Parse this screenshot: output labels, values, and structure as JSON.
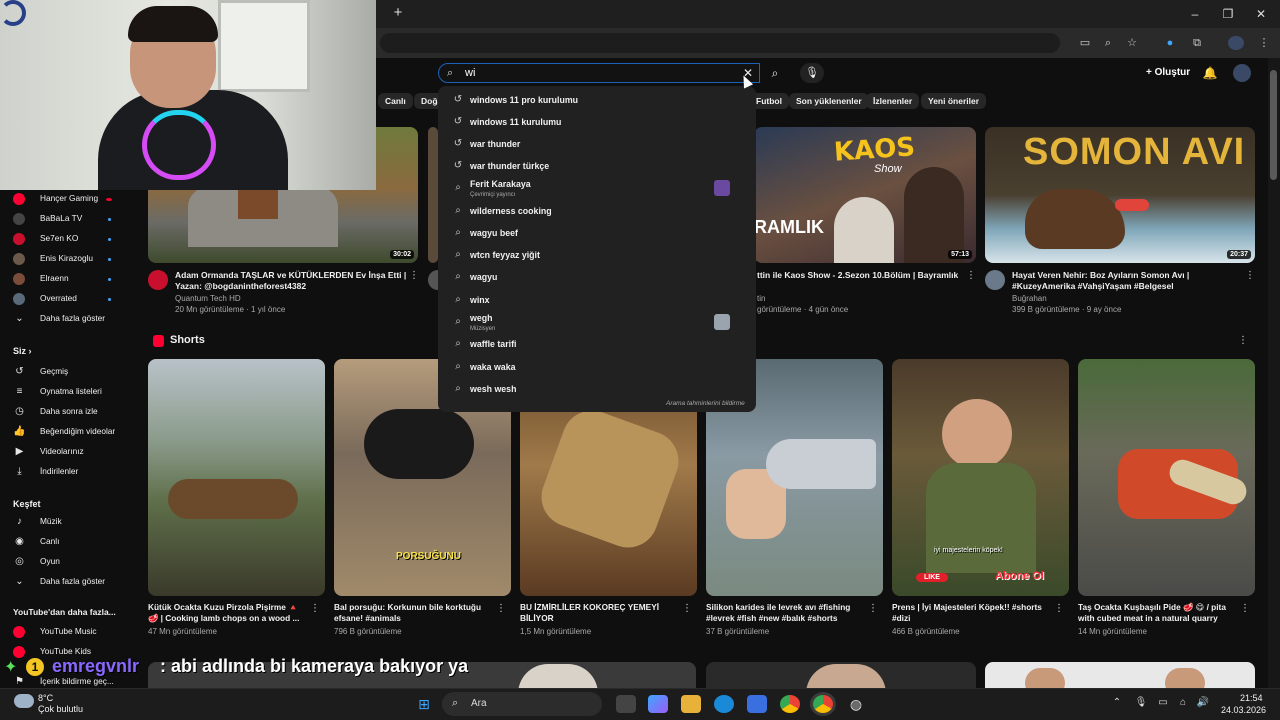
{
  "browser": {
    "new_tab_label": "+",
    "window_controls": [
      "–",
      "❐",
      "✕"
    ]
  },
  "header": {
    "search_query": "wi",
    "create_label": "Oluştur"
  },
  "chips": [
    "Canlı",
    "Doğa",
    "Futbol",
    "Son yüklenenler",
    "İzlenenler",
    "Yeni öneriler"
  ],
  "search_suggestions": [
    {
      "text": "windows 11 pro kurulumu",
      "icon": "history-icon"
    },
    {
      "text": "windows 11 kurulumu",
      "icon": "history-icon"
    },
    {
      "text": "war thunder",
      "icon": "history-icon"
    },
    {
      "text": "war thunder türkçe",
      "icon": "history-icon"
    },
    {
      "text": "Ferit Karakaya",
      "sub": "Çevrimiçi yayıncı",
      "icon": "search-icon"
    },
    {
      "text": "wilderness cooking",
      "icon": "search-icon"
    },
    {
      "text": "wagyu beef",
      "icon": "search-icon"
    },
    {
      "text": "wtcn feyyaz yiğit",
      "icon": "search-icon"
    },
    {
      "text": "wagyu",
      "icon": "search-icon"
    },
    {
      "text": "winx",
      "icon": "search-icon"
    },
    {
      "text": "wegh",
      "sub": "Müzisyen",
      "icon": "search-icon"
    },
    {
      "text": "waffle tarifi",
      "icon": "search-icon"
    },
    {
      "text": "waka waka",
      "icon": "search-icon"
    },
    {
      "text": "wesh wesh",
      "icon": "search-icon"
    }
  ],
  "report_suggestions_label": "Arama tahminlerini bildirme",
  "sidebar": {
    "subscriptions": [
      {
        "label": "Hançer Gaming",
        "live": true,
        "color": "#ff0033"
      },
      {
        "label": "BaBaLa TV",
        "color": "#444"
      },
      {
        "label": "Se7en KO",
        "color": "#c8102e"
      },
      {
        "label": "Enis Kirazoglu",
        "color": "#6b5a4a"
      },
      {
        "label": "Elraenn",
        "color": "#7a4c3a"
      },
      {
        "label": "Overrated",
        "color": "#5a6a7a"
      }
    ],
    "show_more_1": "Daha fazla göster",
    "you_heading": "Siz",
    "you_items": [
      "Geçmiş",
      "Oynatma listeleri",
      "Daha sonra izle",
      "Beğendiğim videolar",
      "Videolarınız",
      "İndirilenler"
    ],
    "explore_heading": "Keşfet",
    "explore_items": [
      "Müzik",
      "Canlı",
      "Oyun"
    ],
    "show_more_2": "Daha fazla göster",
    "more_heading": "YouTube'dan daha fazla...",
    "more_items": [
      "YouTube Music",
      "YouTube Kids",
      "İçerik bildirme geç..."
    ]
  },
  "videos": [
    {
      "title": "Adam Ormanda TAŞLAR ve KÜTÜKLERDEN Ev İnşa Etti | Yazan: @bogdanintheforest4382",
      "channel": "Quantum Tech HD",
      "meta": "20 Mn görüntüleme · 1 yıl önce",
      "duration": "30:02"
    },
    {
      "title": "ttin ile Kaos Show - 2.Sezon 10.Bölüm | Bayramlık",
      "channel": "tin",
      "meta": "görüntüleme · 4 gün önce",
      "duration": "57:13"
    },
    {
      "title": "Hayat Veren Nehir: Boz Ayıların Somon Avı | #KuzeyAmerika #VahşiYaşam #Belgesel",
      "channel": "Buğrahan",
      "meta": "399 B görüntüleme · 9 ay önce",
      "duration": "20:37"
    }
  ],
  "thumb_texts": {
    "kaos": "KAOS",
    "show": "Show",
    "ramlik": "RAMLIK",
    "somon": "SOMON AVI"
  },
  "shorts_heading": "Shorts",
  "shorts": [
    {
      "title": "Kütük Ocakta Kuzu Pirzola Pişirme 🔺 🥩 | Cooking lamb chops on a wood ...",
      "meta": "47 Mn görüntüleme"
    },
    {
      "title": "Bal porsuğu: Korkunun bile korktuğu efsane! #animals",
      "meta": "796 B görüntüleme",
      "overlay": "PORSUĞUNU"
    },
    {
      "title": "BU İZMİRLİLER KOKOREÇ YEMEYİ BİLİYOR",
      "meta": "1,5 Mn görüntüleme"
    },
    {
      "title": "Silikon karides ile levrek avı #fishing #levrek #fish #new #balık #shorts",
      "meta": "37 B görüntüleme"
    },
    {
      "title": "Prens | İyi Majesteleri Köpek!! #shorts #dizi",
      "meta": "466 B görüntüleme",
      "overlay": "iyi majestelerin köpek!",
      "like": "LIKE",
      "subscribe": "Abone Ol"
    },
    {
      "title": "Taş Ocakta Kuşbaşılı Pide 🥩 😋 / pita with cubed meat in a natural quarry",
      "meta": "14 Mn görüntüleme"
    }
  ],
  "chat": {
    "badge": "1",
    "user": "emregvnlr",
    "message": ": abi adlında bi kameraya bakıyor ya"
  },
  "taskbar": {
    "temp": "8°C",
    "weather": "Çok bulutlu",
    "search_placeholder": "Ara",
    "time": "21:54",
    "date": "24.03.2026"
  }
}
